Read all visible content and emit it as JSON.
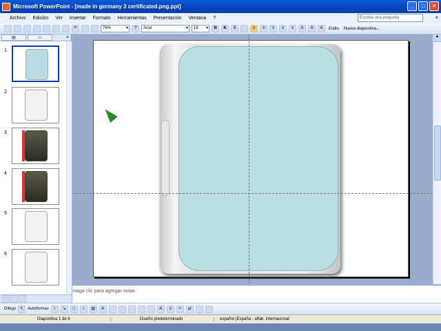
{
  "window": {
    "title": "Microsoft PowerPoint - [made in germany 3 certificated.png.ppt]"
  },
  "menu": {
    "items": [
      "Archivo",
      "Edición",
      "Ver",
      "Insertar",
      "Formato",
      "Herramientas",
      "Presentación",
      "Ventana",
      "?"
    ],
    "ask_placeholder": "Escriba una pregunta"
  },
  "toolbar": {
    "zoom": "76%",
    "font": "Arial",
    "size": "18",
    "bold": "N",
    "italic": "K",
    "underline": "S",
    "design": "Estilo",
    "new_slide": "Nueva diapositiva..."
  },
  "slides": [
    {
      "num": "1",
      "kind": "blue"
    },
    {
      "num": "2",
      "kind": "blank"
    },
    {
      "num": "3",
      "kind": "photo"
    },
    {
      "num": "4",
      "kind": "photo"
    },
    {
      "num": "5",
      "kind": "blank"
    },
    {
      "num": "6",
      "kind": "blank"
    }
  ],
  "notes": {
    "placeholder": "Haga clic para agregar notas"
  },
  "drawing": {
    "draw_label": "Dibujo",
    "autoshapes_label": "Autoformas"
  },
  "status": {
    "slide": "Diapositiva 1 de 6",
    "design": "Diseño predeterminado",
    "language": "español (España - alfab. internacional"
  },
  "colors": {
    "title_bar": "#0a4bc6",
    "cover": "#b9dfe3",
    "workspace": "#9aabcc"
  }
}
